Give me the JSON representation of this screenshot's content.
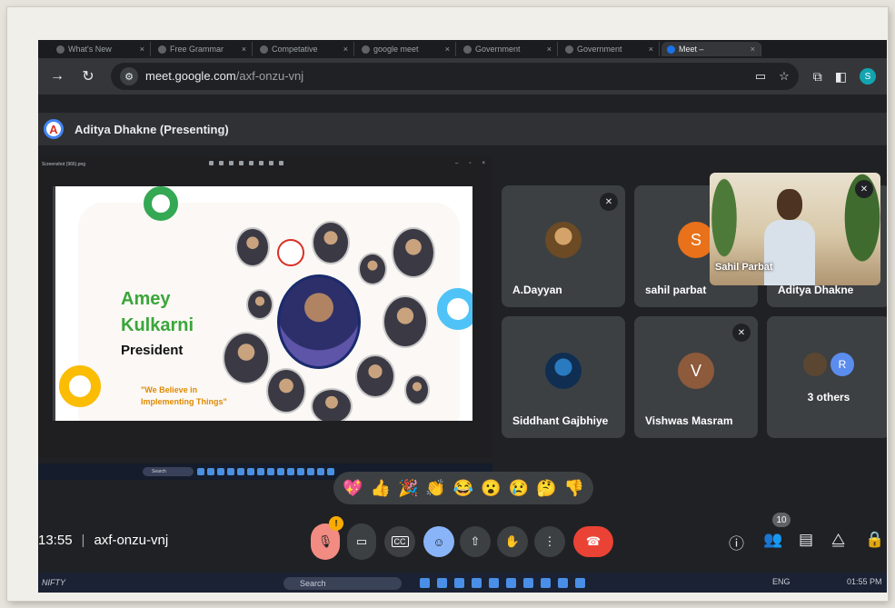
{
  "browser": {
    "tabs": [
      {
        "label": "What's New",
        "active": false
      },
      {
        "label": "Free Grammar",
        "active": false
      },
      {
        "label": "Competative",
        "active": false
      },
      {
        "label": "google meet",
        "active": false
      },
      {
        "label": "Government",
        "active": false
      },
      {
        "label": "Government",
        "active": false
      },
      {
        "label": "Meet –",
        "active": true
      }
    ],
    "url_host": "meet.google.com",
    "url_path": "/axf-onzu-vnj",
    "profile_initial": "S"
  },
  "presenter": {
    "initial": "A",
    "label": "Aditya Dhakne (Presenting)"
  },
  "slide": {
    "file_name": "Screenshot (966).png",
    "name_line1": "Amey",
    "name_line2": "Kulkarni",
    "role": "President",
    "quote_line1": "\"We Believe in",
    "quote_line2": "Implementing Things\"",
    "mini_search": "Search"
  },
  "participants": {
    "dayyan": "A.Dayyan",
    "sahil_initial": "S",
    "sahil": "sahil parbat",
    "aditya": "Aditya Dhakne",
    "selfview_name": "Sahil Parbat",
    "siddhant": "Siddhant Gajbhiye",
    "vishwas_initial": "V",
    "vishwas": "Vishwas Masram",
    "others_initial": "R",
    "others": "3 others"
  },
  "reactions": [
    "💖",
    "👍",
    "🎉",
    "👏",
    "😂",
    "😮",
    "😢",
    "🤔",
    "👎"
  ],
  "bottom": {
    "time": "13:55",
    "meeting_code": "axf-onzu-vnj",
    "mic_alert": "!",
    "cc_label": "CC",
    "people_count": "10"
  },
  "os_taskbar": {
    "ticker": "NIFTY",
    "search": "Search",
    "lang": "ENG",
    "clock": "01:55 PM"
  },
  "colors": {
    "end_call": "#ea4335",
    "mic_off": "#f28b82",
    "reactions_button": "#8ab4f8"
  }
}
